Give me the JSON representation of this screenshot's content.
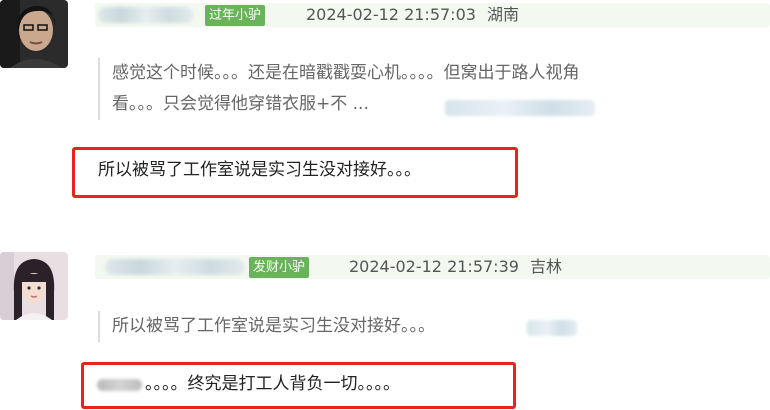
{
  "comments": [
    {
      "badge": "过年小驴",
      "timestamp": "2024-02-12 21:57:03",
      "location": "湖南",
      "quote_lines": [
        "感觉这个时候。。。还是在暗戳戳耍心机。。。。但窝出于路人视角",
        "看。。。只会觉得他穿错衣服+不 ..."
      ],
      "reply": "所以被骂了工作室说是实习生没对接好。。。"
    },
    {
      "badge": "发财小驴",
      "timestamp": "2024-02-12 21:57:39",
      "location": "吉林",
      "quote_lines": [
        "所以被骂了工作室说是实习生没对接好。。。"
      ],
      "reply": "。。。。终究是打工人背负一切。。。。"
    }
  ],
  "colors": {
    "badge_green": "#69b45a",
    "highlight_red": "#e8231e",
    "header_bg": "#f3f9f1"
  }
}
